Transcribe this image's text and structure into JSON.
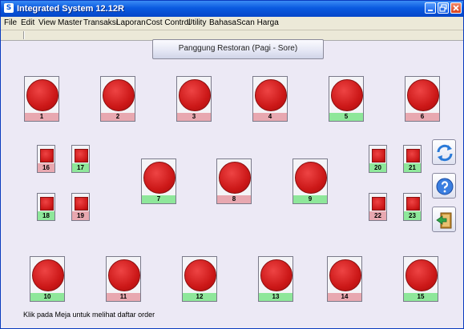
{
  "window": {
    "title": "Integrated System 12.12R",
    "app_icon_glyph": "S"
  },
  "menu": [
    "File",
    "Edit",
    "View",
    "Master",
    "Transaksi",
    "Laporan",
    "Cost Control",
    "Utility",
    "Bahasa",
    "Scan Harga"
  ],
  "header": {
    "title": "Panggung Restoran (Pagi - Sore)"
  },
  "tables": [
    {
      "number": "1",
      "status": "pink"
    },
    {
      "number": "2",
      "status": "pink"
    },
    {
      "number": "3",
      "status": "pink"
    },
    {
      "number": "4",
      "status": "pink"
    },
    {
      "number": "5",
      "status": "green"
    },
    {
      "number": "6",
      "status": "pink"
    },
    {
      "number": "7",
      "status": "green"
    },
    {
      "number": "8",
      "status": "pink"
    },
    {
      "number": "9",
      "status": "green"
    },
    {
      "number": "10",
      "status": "green"
    },
    {
      "number": "11",
      "status": "pink"
    },
    {
      "number": "12",
      "status": "green"
    },
    {
      "number": "13",
      "status": "green"
    },
    {
      "number": "14",
      "status": "pink"
    },
    {
      "number": "15",
      "status": "green"
    },
    {
      "number": "16",
      "status": "pink"
    },
    {
      "number": "17",
      "status": "green"
    },
    {
      "number": "18",
      "status": "green"
    },
    {
      "number": "19",
      "status": "pink"
    },
    {
      "number": "20",
      "status": "green"
    },
    {
      "number": "21",
      "status": "green"
    },
    {
      "number": "22",
      "status": "pink"
    },
    {
      "number": "23",
      "status": "green"
    }
  ],
  "side_buttons": [
    {
      "icon": "refresh-icon"
    },
    {
      "icon": "help-icon"
    },
    {
      "icon": "exit-icon"
    }
  ],
  "status": {
    "hint": "Klik pada Meja untuk melihat daftar order"
  },
  "colors": {
    "title_bar": "#0a5ae0",
    "available": "#8ee79a",
    "occupied": "#e8a8b0",
    "table_red": "#cc1818"
  }
}
